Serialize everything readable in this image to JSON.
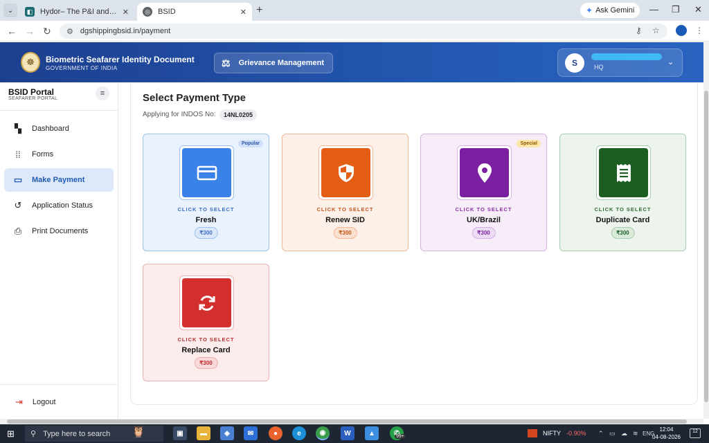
{
  "browser": {
    "tabs": [
      {
        "title": "Hydor– The P&I and Marine Lia",
        "active": false
      },
      {
        "title": "BSID",
        "active": true
      }
    ],
    "ask_gemini": "Ask Gemini",
    "url": "dgshippingbsid.in/payment"
  },
  "header": {
    "title": "Biometric Seafarer Identity Document",
    "subtitle": "GOVERNMENT OF INDIA",
    "grievance_label": "Grievance Management",
    "user": {
      "initial": "S",
      "name": "(redacted)",
      "role": "HQ"
    }
  },
  "sidebar": {
    "title": "BSID Portal",
    "subtitle": "SEAFARER PORTAL",
    "items": [
      {
        "label": "Dashboard",
        "icon": "dashboard-icon",
        "active": false
      },
      {
        "label": "Forms",
        "icon": "grid-icon",
        "active": false
      },
      {
        "label": "Make Payment",
        "icon": "card-icon",
        "active": true
      },
      {
        "label": "Application Status",
        "icon": "history-icon",
        "active": false
      },
      {
        "label": "Print Documents",
        "icon": "printer-icon",
        "active": false
      }
    ],
    "logout_label": "Logout"
  },
  "main": {
    "page_title": "Select Payment Type",
    "indos_label": "Applying for INDOS No:",
    "indos_value": "14NL0205",
    "cards": [
      {
        "name": "Fresh",
        "cta": "CLICK TO SELECT",
        "price": "₹300",
        "badge": "Popular",
        "icon": "credit-card-icon",
        "accent": "#3b82e8"
      },
      {
        "name": "Renew SID",
        "cta": "CLICK TO SELECT",
        "price": "₹300",
        "badge": "",
        "icon": "shield-icon",
        "accent": "#e35d12"
      },
      {
        "name": "UK/Brazil",
        "cta": "CLICK TO SELECT",
        "price": "₹300",
        "badge": "Special",
        "icon": "location-pin-icon",
        "accent": "#7b1fa2"
      },
      {
        "name": "Duplicate Card",
        "cta": "CLICK TO SELECT",
        "price": "₹300",
        "badge": "",
        "icon": "receipt-icon",
        "accent": "#1c5e22"
      },
      {
        "name": "Replace Card",
        "cta": "CLICK TO SELECT",
        "price": "₹300",
        "badge": "",
        "icon": "refresh-icon",
        "accent": "#d32f2f"
      }
    ]
  },
  "taskbar": {
    "search_placeholder": "Type here to search",
    "whatsapp_badge": "99+",
    "nifty_label": "NIFTY",
    "nifty_change": "-0.90%",
    "language": "ENG",
    "time": "12:04",
    "date": "04-08-2026",
    "notifications": "12"
  }
}
